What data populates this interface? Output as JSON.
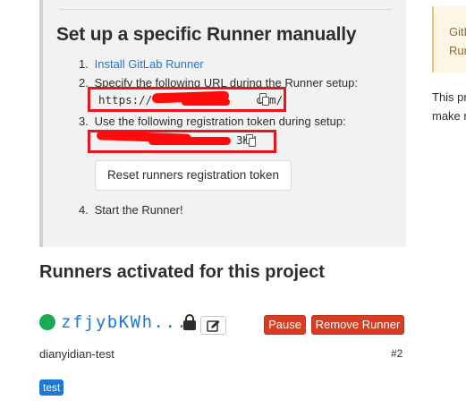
{
  "setup": {
    "title": "Set up a specific Runner manually",
    "steps": [
      {
        "num": "1.",
        "link": "Install GitLab Runner"
      },
      {
        "num": "2.",
        "text": "Specify the following URL during the Runner setup:"
      },
      {
        "num": "3.",
        "text": "Use the following registration token during setup:"
      },
      {
        "num": "4.",
        "text": "Start the Runner!"
      }
    ],
    "url_prefix": "https://",
    "url_suffix": "com/",
    "token_suffix": "3KH",
    "reset_button": "Reset runners registration token"
  },
  "side": {
    "alert_text": "GitLab Runner in t",
    "info_text_1": "This pr",
    "info_text_2": "make r"
  },
  "activated": {
    "title": "Runners activated for this project",
    "runner": {
      "id": "zfjybKWh...",
      "pause_label": "Pause",
      "remove_label": "Remove Runner",
      "description": "dianyidian-test",
      "number": "#2",
      "tag": "test",
      "status_color": "#1aaa55"
    }
  },
  "colors": {
    "danger": "#db3b21",
    "link": "#1f78d1",
    "annotation": "#e8141e"
  },
  "icons": [
    "copy-icon",
    "lock-icon",
    "pencil-icon"
  ]
}
